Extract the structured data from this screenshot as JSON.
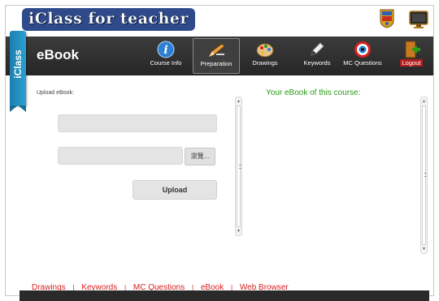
{
  "app": {
    "logo_text": "iClass for teacher",
    "side_tab": "iClass"
  },
  "toolbar": {
    "title": "eBook",
    "nav": [
      {
        "label": "Course Info",
        "icon": "info-icon"
      },
      {
        "label": "Preparation",
        "icon": "pencil-icon"
      },
      {
        "label": "Drawings",
        "icon": "palette-icon"
      },
      {
        "label": "Keywords",
        "icon": "marker-icon"
      },
      {
        "label": "MC Questions",
        "icon": "target-icon"
      },
      {
        "label": "Logout",
        "icon": "logout-door-icon"
      }
    ],
    "active": "Preparation"
  },
  "upload": {
    "label": "Upload eBook:",
    "browse_label": "瀏覽...",
    "upload_label": "Upload"
  },
  "ebook_panel": {
    "heading": "Your eBook of this course:"
  },
  "footer": {
    "links": [
      "Drawings",
      "Keywords",
      "MC Questions",
      "eBook",
      "Web Browser"
    ],
    "separator": "|"
  },
  "colors": {
    "toolbar_bg": "#2e2e2e",
    "side_tab": "#2496c8",
    "heading_green": "#2a9a18",
    "footer_red": "#d82020",
    "logout_red": "#b21f1f"
  }
}
